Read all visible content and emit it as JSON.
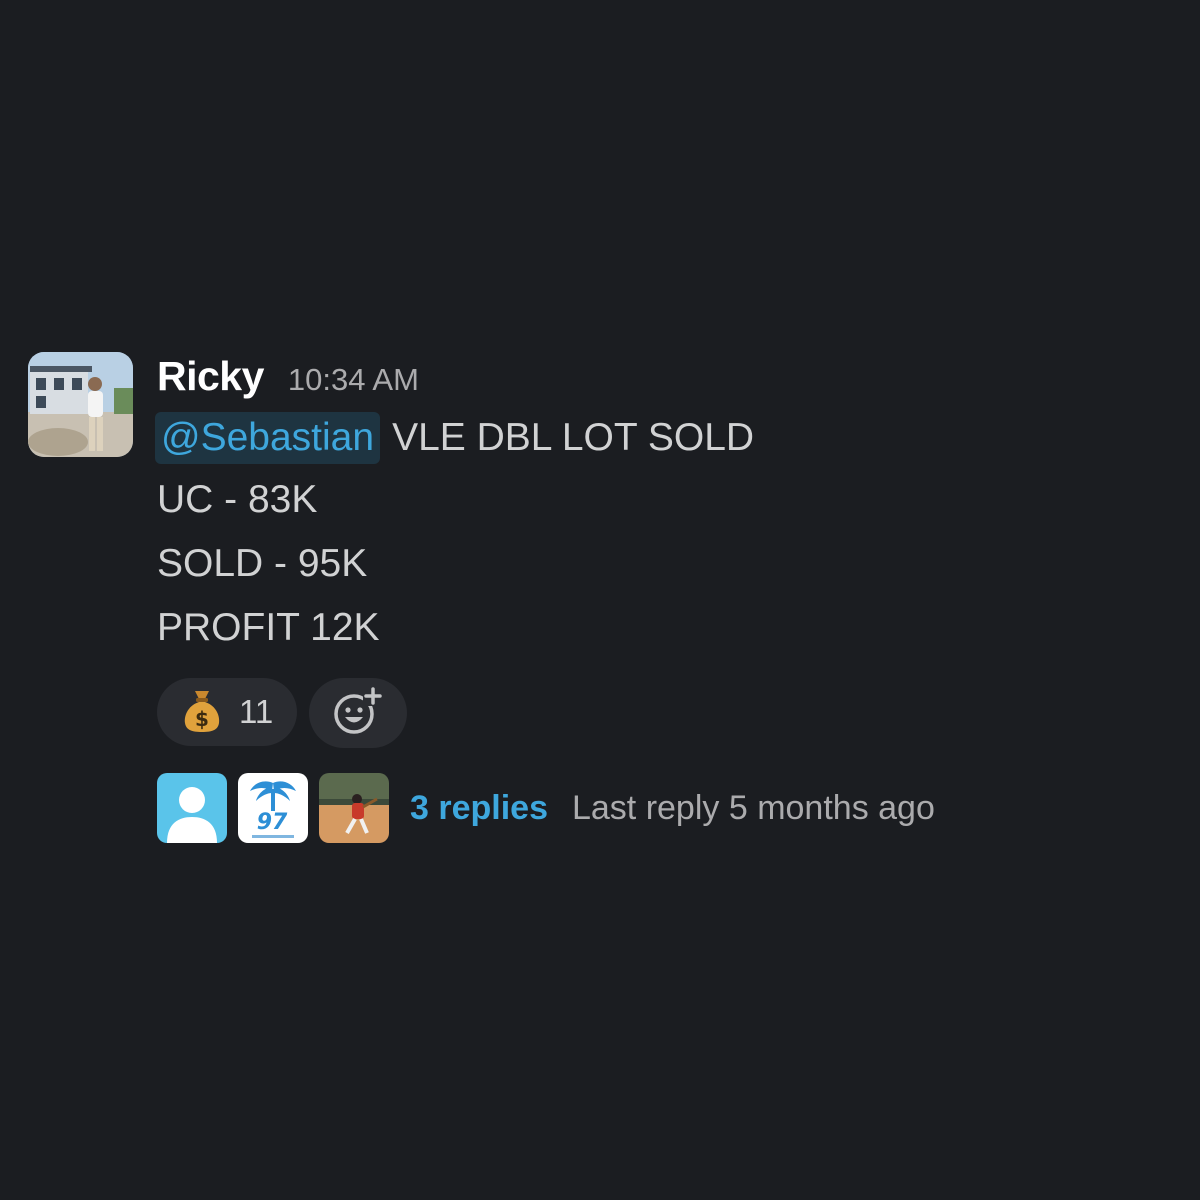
{
  "message": {
    "author": "Ricky",
    "timestamp": "10:34 AM",
    "mention": "@Sebastian",
    "first_line_text": "VLE DBL LOT SOLD",
    "lines": [
      "UC - 83K",
      "SOLD - 95K",
      "PROFIT 12K"
    ]
  },
  "reactions": [
    {
      "emoji": "money-bag-icon",
      "count": "11"
    }
  ],
  "add_reaction_icon": "add-reaction-icon",
  "thread": {
    "reply_avatars": [
      "default-user-avatar",
      "palm-97-logo-avatar",
      "baseball-player-avatar"
    ],
    "replies_label": "3 replies",
    "last_reply_label": "Last reply 5 months ago"
  },
  "colors": {
    "background": "#1b1d21",
    "mention_text": "#3ea7dd",
    "mention_bg": "#1e3441",
    "link": "#3ea7dd",
    "muted": "#ababad",
    "text": "#d1d2d3",
    "pill": "#2a2c31"
  }
}
